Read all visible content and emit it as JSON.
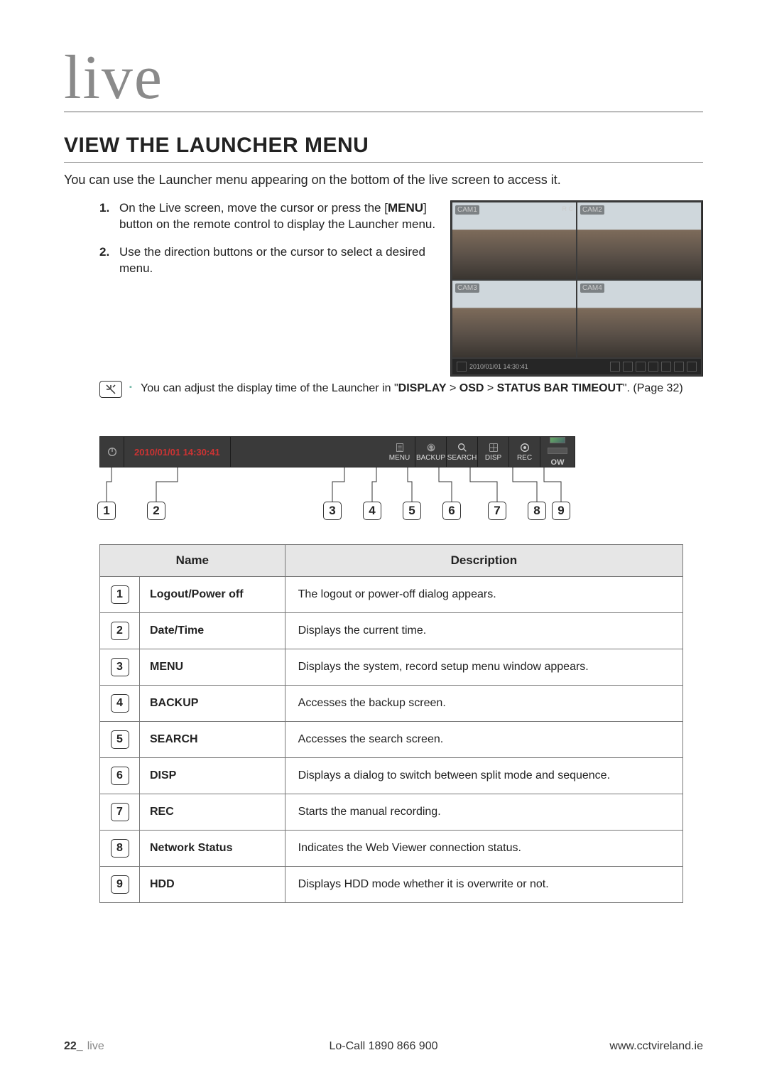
{
  "chapter_title": "live",
  "section_title": "VIEW THE LAUNCHER MENU",
  "intro": "You can use the Launcher menu appearing on the bottom of the live screen to access it.",
  "steps": [
    {
      "num": "1.",
      "pre": "On the Live screen, move the cursor or press the [",
      "bold": "MENU",
      "post": "] button on the remote control to display the Launcher menu."
    },
    {
      "num": "2.",
      "pre": "Use the direction buttons or the cursor to select a desired menu.",
      "bold": "",
      "post": ""
    }
  ],
  "note": {
    "pre": "You can adjust the display time of the Launcher in \"",
    "bold1": "DISPLAY",
    "mid": " > ",
    "bold2": "OSD",
    "mid2": " > ",
    "bold3": "STATUS BAR TIMEOUT",
    "post": "\". (Page 32)"
  },
  "preview": {
    "cams": [
      "CAM1",
      "CAM2",
      "CAM3",
      "CAM4"
    ],
    "rec": "R C",
    "datetime": "2010/01/01 14:30:41"
  },
  "launcher": {
    "datetime": "2010/01/01 14:30:41",
    "items": [
      {
        "label": "MENU"
      },
      {
        "label": "BACKUP"
      },
      {
        "label": "SEARCH"
      },
      {
        "label": "DISP"
      },
      {
        "label": "REC"
      }
    ],
    "right_text": "OW"
  },
  "badges": [
    "1",
    "2",
    "3",
    "4",
    "5",
    "6",
    "7",
    "8",
    "9"
  ],
  "table": {
    "headers": {
      "name": "Name",
      "desc": "Description"
    },
    "rows": [
      {
        "n": "1",
        "name": "Logout/Power off",
        "desc": "The logout or power-off dialog appears."
      },
      {
        "n": "2",
        "name": "Date/Time",
        "desc": "Displays the current time."
      },
      {
        "n": "3",
        "name": "MENU",
        "desc": "Displays the system, record setup menu window appears."
      },
      {
        "n": "4",
        "name": "BACKUP",
        "desc": "Accesses the backup screen."
      },
      {
        "n": "5",
        "name": "SEARCH",
        "desc": "Accesses the search screen."
      },
      {
        "n": "6",
        "name": "DISP",
        "desc": "Displays a dialog to switch between split mode and sequence."
      },
      {
        "n": "7",
        "name": "REC",
        "desc": "Starts the manual recording."
      },
      {
        "n": "8",
        "name": "Network Status",
        "desc": "Indicates the Web Viewer connection status."
      },
      {
        "n": "9",
        "name": "HDD",
        "desc": "Displays HDD mode whether it is overwrite or not."
      }
    ]
  },
  "footer": {
    "page": "22_",
    "section": "live",
    "center": "Lo-Call  1890 866 900",
    "right": "www.cctvireland.ie"
  }
}
